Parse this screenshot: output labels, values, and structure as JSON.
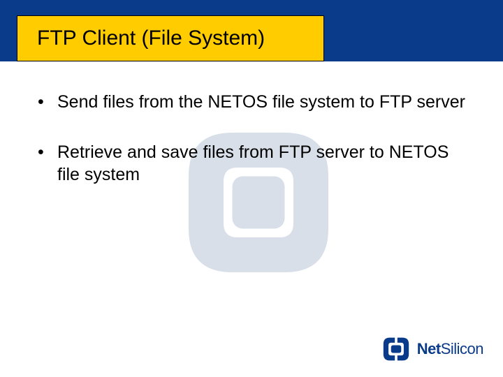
{
  "colors": {
    "header": "#0a3a8a",
    "titleBg": "#ffcc00",
    "watermark": "#d4dce6",
    "logoBlue": "#0a3a8a"
  },
  "title": "FTP Client (File System)",
  "bullets": [
    "Send files from the NETOS file system to FTP server",
    "Retrieve and save files from FTP server to NETOS file system"
  ],
  "brand": {
    "bold": "Net",
    "rest": "Silicon"
  }
}
